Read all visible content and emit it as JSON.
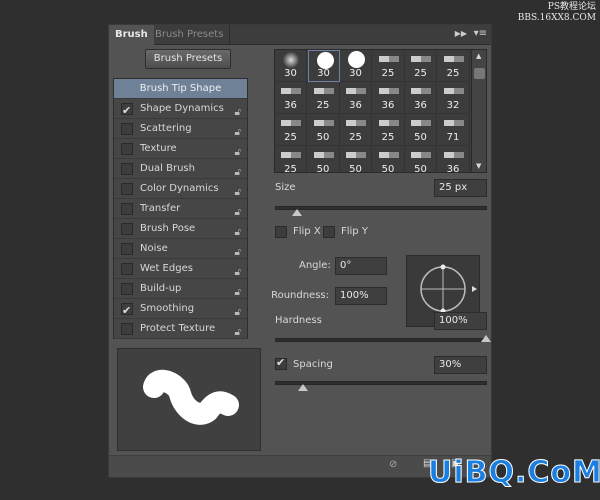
{
  "watermark_top": "PS教程论坛\nBBS.16XX8.COM",
  "watermark_bottom": "UiBQ.CoM",
  "tabs": [
    {
      "label": "Brush",
      "active": true
    },
    {
      "label": "Brush Presets",
      "active": false
    }
  ],
  "brush_presets_button": "Brush Presets",
  "list": [
    {
      "label": "Brush Tip Shape",
      "selected": true
    },
    {
      "label": "Shape Dynamics",
      "checked": true,
      "lock": true
    },
    {
      "label": "Scattering",
      "checked": false,
      "lock": true
    },
    {
      "label": "Texture",
      "checked": false,
      "lock": true
    },
    {
      "label": "Dual Brush",
      "checked": false,
      "lock": true
    },
    {
      "label": "Color Dynamics",
      "checked": false,
      "lock": true
    },
    {
      "label": "Transfer",
      "checked": false,
      "lock": true
    },
    {
      "label": "Brush Pose",
      "checked": false,
      "lock": true
    },
    {
      "label": "Noise",
      "checked": false,
      "lock": true
    },
    {
      "label": "Wet Edges",
      "checked": false,
      "lock": true
    },
    {
      "label": "Build-up",
      "checked": false,
      "lock": true
    },
    {
      "label": "Smoothing",
      "checked": true,
      "lock": true
    },
    {
      "label": "Protect Texture",
      "checked": false,
      "lock": true
    }
  ],
  "brush_sizes": [
    "30",
    "30",
    "30",
    "25",
    "25",
    "25",
    "36",
    "25",
    "36",
    "36",
    "36",
    "32",
    "25",
    "50",
    "25",
    "25",
    "50",
    "71",
    "25",
    "50",
    "50",
    "50",
    "50",
    "36"
  ],
  "selected_brush_index": 1,
  "size": {
    "label": "Size",
    "value": "25 px",
    "slider_fraction": 0.1
  },
  "flip_x": {
    "label": "Flip X",
    "checked": false
  },
  "flip_y": {
    "label": "Flip Y",
    "checked": false
  },
  "angle": {
    "label": "Angle:",
    "value": "0°"
  },
  "roundness": {
    "label": "Roundness:",
    "value": "100%"
  },
  "hardness": {
    "label": "Hardness",
    "value": "100%",
    "slider_fraction": 1.0
  },
  "spacing": {
    "label": "Spacing",
    "value": "30%",
    "checked": true,
    "slider_fraction": 0.13
  },
  "colors": {
    "panel": "#535353",
    "selected_item": "#6e8196",
    "watermark": "#1a7fe0"
  }
}
